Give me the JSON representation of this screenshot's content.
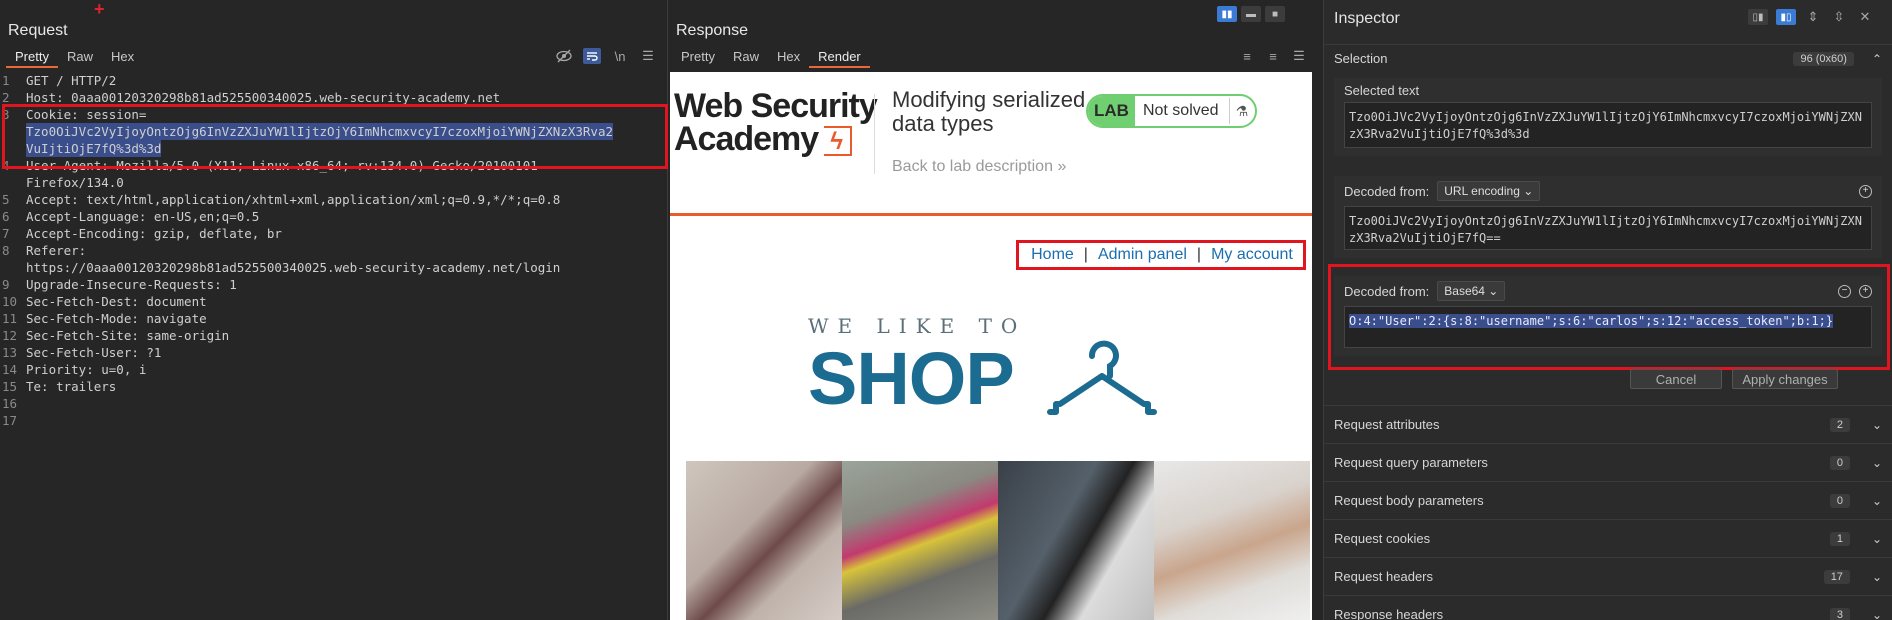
{
  "request": {
    "title": "Request",
    "tabs": [
      "Pretty",
      "Raw",
      "Hex"
    ],
    "newline_toggle": "\\n",
    "lines": [
      {
        "n": "1",
        "text": "GET / HTTP/2"
      },
      {
        "n": "2",
        "text": "Host: 0aaa00120320298b81ad525500340025.web-security-academy.net"
      },
      {
        "n": "3",
        "text": "Cookie: session="
      },
      {
        "n": "",
        "text": "Tzo0OiJVc2VyIjoyOntzOjg6InVzZXJuYW1lIjtzOjY6ImNhcmxvcyI7czoxMjoiYWNjZXNzX3Rva2",
        "hl": true
      },
      {
        "n": "",
        "text": "VuIjtiOjE7fQ%3d%3d",
        "hl": true
      },
      {
        "n": "4",
        "text": "User-Agent: Mozilla/5.0 (X11; Linux x86_64; rv:134.0) Gecko/20100101"
      },
      {
        "n": "",
        "text": "Firefox/134.0"
      },
      {
        "n": "5",
        "text": "Accept: text/html,application/xhtml+xml,application/xml;q=0.9,*/*;q=0.8"
      },
      {
        "n": "6",
        "text": "Accept-Language: en-US,en;q=0.5"
      },
      {
        "n": "7",
        "text": "Accept-Encoding: gzip, deflate, br"
      },
      {
        "n": "8",
        "text": "Referer:"
      },
      {
        "n": "",
        "text": "https://0aaa00120320298b81ad525500340025.web-security-academy.net/login"
      },
      {
        "n": "9",
        "text": "Upgrade-Insecure-Requests: 1"
      },
      {
        "n": "10",
        "text": "Sec-Fetch-Dest: document"
      },
      {
        "n": "11",
        "text": "Sec-Fetch-Mode: navigate"
      },
      {
        "n": "12",
        "text": "Sec-Fetch-Site: same-origin"
      },
      {
        "n": "13",
        "text": "Sec-Fetch-User: ?1"
      },
      {
        "n": "14",
        "text": "Priority: u=0, i"
      },
      {
        "n": "15",
        "text": "Te: trailers"
      },
      {
        "n": "16",
        "text": ""
      },
      {
        "n": "17",
        "text": ""
      }
    ]
  },
  "response": {
    "title": "Response",
    "tabs": [
      "Pretty",
      "Raw",
      "Hex",
      "Render"
    ],
    "render": {
      "logo_line1": "Web Security",
      "logo_line2": "Academy",
      "lab_title": "Modifying serialized data types",
      "back_link": "Back to lab description",
      "lab_tag": "LAB",
      "lab_state": "Not solved",
      "nav": [
        "Home",
        "Admin panel",
        "My account"
      ],
      "nav_sep": "|",
      "shop_small": "WE LIKE TO",
      "shop_big": "SHOP"
    }
  },
  "inspector": {
    "title": "Inspector",
    "selection_label": "Selection",
    "selection_count": "96 (0x60)",
    "selected_text_label": "Selected text",
    "selected_text": "Tzo0OiJVc2VyIjoyOntzOjg6InVzZXJuYW1lIjtzOjY6ImNhcmxvcyI7czoxMjoiYWNjZXNzX3Rva2VuIjtiOjE7fQ%3d%3d",
    "decoded1_label": "Decoded from:",
    "decoded1_encoding": "URL encoding",
    "decoded1_text": "Tzo0OiJVc2VyIjoyOntzOjg6InVzZXJuYW1lIjtzOjY6ImNhcmxvcyI7czoxMjoiYWNjZXNzX3Rva2VuIjtiOjE7fQ==",
    "decoded2_label": "Decoded from:",
    "decoded2_encoding": "Base64",
    "decoded2_text": "O:4:\"User\":2:{s:8:\"username\";s:6:\"carlos\";s:12:\"access_token\";b:1;}",
    "cancel": "Cancel",
    "apply": "Apply changes",
    "sections": [
      {
        "label": "Request attributes",
        "count": "2"
      },
      {
        "label": "Request query parameters",
        "count": "0"
      },
      {
        "label": "Request body parameters",
        "count": "0"
      },
      {
        "label": "Request cookies",
        "count": "1"
      },
      {
        "label": "Request headers",
        "count": "17"
      },
      {
        "label": "Response headers",
        "count": "3"
      }
    ]
  },
  "colors": {
    "accent_orange": "#e8683a",
    "highlight": "#3b4e8c",
    "annotation_red": "#e0151f",
    "lab_green": "#70cf70",
    "link_blue": "#1a6fb0"
  }
}
